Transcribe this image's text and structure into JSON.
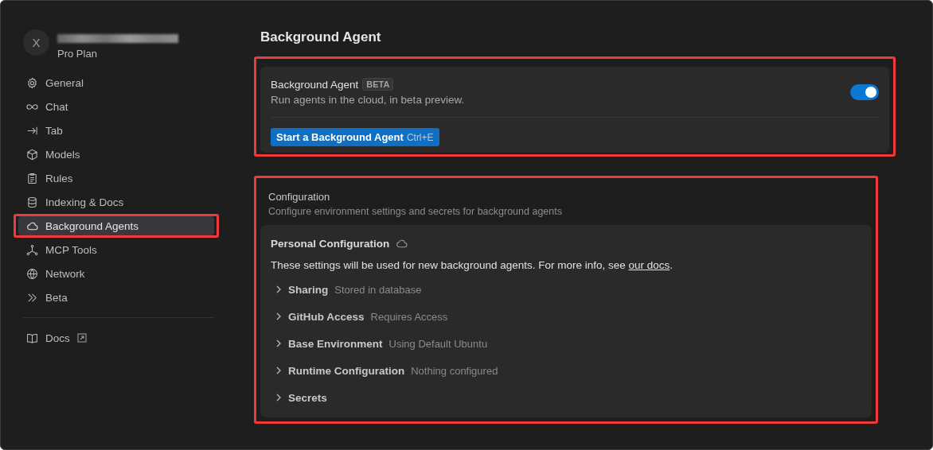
{
  "account": {
    "avatar_letter": "X",
    "plan": "Pro Plan"
  },
  "sidebar": {
    "items": [
      {
        "label": "General",
        "selected": false,
        "highlighted": false
      },
      {
        "label": "Chat",
        "selected": false,
        "highlighted": false
      },
      {
        "label": "Tab",
        "selected": false,
        "highlighted": false
      },
      {
        "label": "Models",
        "selected": false,
        "highlighted": false
      },
      {
        "label": "Rules",
        "selected": false,
        "highlighted": false
      },
      {
        "label": "Indexing & Docs",
        "selected": false,
        "highlighted": false
      },
      {
        "label": "Background Agents",
        "selected": true,
        "highlighted": true
      },
      {
        "label": "MCP Tools",
        "selected": false,
        "highlighted": false
      },
      {
        "label": "Network",
        "selected": false,
        "highlighted": false
      },
      {
        "label": "Beta",
        "selected": false,
        "highlighted": false
      }
    ],
    "footer": [
      {
        "label": "Docs",
        "external": true
      }
    ]
  },
  "page_title": "Background Agent",
  "agent_card": {
    "highlighted": true,
    "title": "Background Agent",
    "badge": "BETA",
    "description": "Run agents in the cloud, in beta preview.",
    "enabled": true,
    "button": {
      "label": "Start a Background Agent",
      "shortcut": "Ctrl+E"
    }
  },
  "configuration": {
    "highlighted": true,
    "title": "Configuration",
    "subtitle": "Configure environment settings and secrets for background agents",
    "personal": {
      "title": "Personal Configuration",
      "text": "These settings will be used for new background agents. For more info, see ",
      "link": "our docs",
      "text_end": ".",
      "sections": [
        {
          "label": "Sharing",
          "status": "Stored in database",
          "expanded": false
        },
        {
          "label": "GitHub Access",
          "status": "Requires Access",
          "expanded": false
        },
        {
          "label": "Base Environment",
          "status": "Using Default Ubuntu",
          "expanded": false
        },
        {
          "label": "Runtime Configuration",
          "status": "Nothing configured",
          "expanded": false
        },
        {
          "label": "Secrets",
          "expanded": false
        }
      ]
    }
  }
}
